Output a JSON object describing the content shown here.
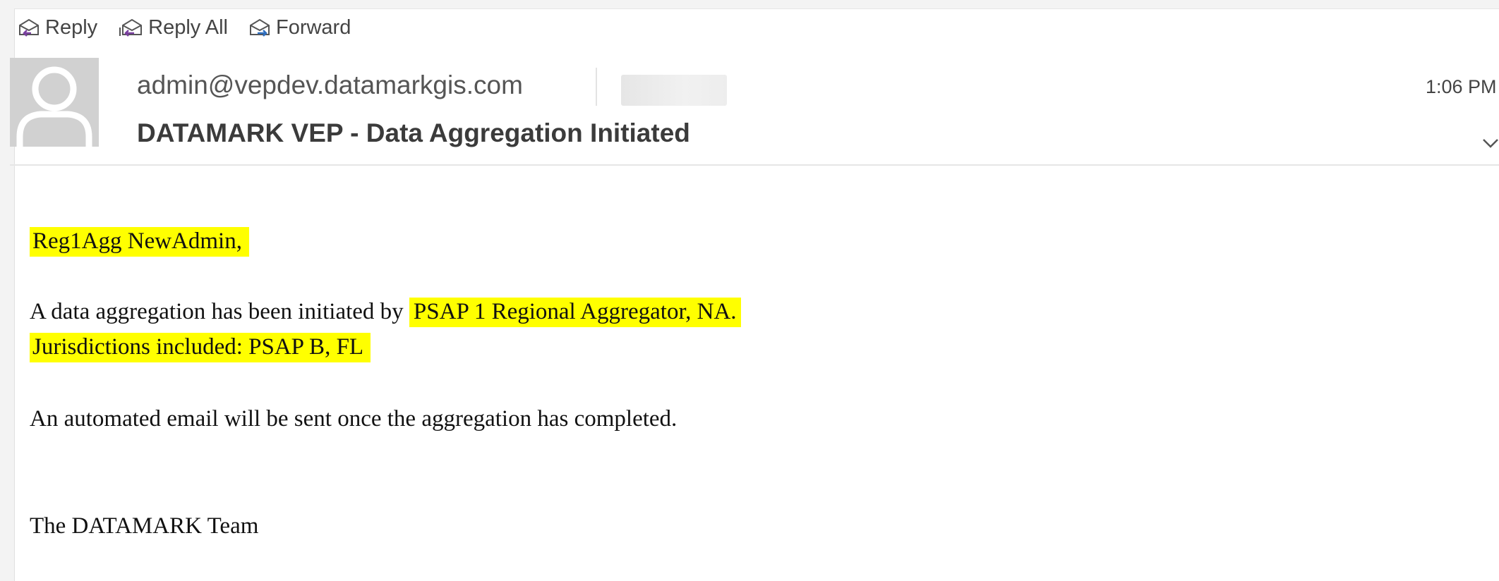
{
  "toolbar": {
    "reply": "Reply",
    "reply_all": "Reply All",
    "forward": "Forward"
  },
  "header": {
    "sender": "admin@vepdev.datamarkgis.com",
    "time": "1:06 PM",
    "subject": "DATAMARK VEP - Data Aggregation Initiated"
  },
  "body": {
    "greeting": "Reg1Agg NewAdmin,",
    "line1_prefix": "A data aggregation has been initiated by",
    "line1_highlight": "PSAP 1 Regional Aggregator, NA.",
    "line2": "Jurisdictions included: PSAP B, FL",
    "line3": "An automated email will be sent once the aggregation has completed.",
    "signature": "The DATAMARK Team"
  },
  "colors": {
    "highlight": "#ffff00",
    "reply_arrow": "#7a3fa0",
    "forward_arrow": "#2f6fc0",
    "avatar_bg": "#d1d1d1"
  },
  "icons": {
    "reply": "reply-icon",
    "reply_all": "reply-all-icon",
    "forward": "forward-icon",
    "avatar": "person-avatar-icon",
    "expand": "chevron-down-icon"
  }
}
